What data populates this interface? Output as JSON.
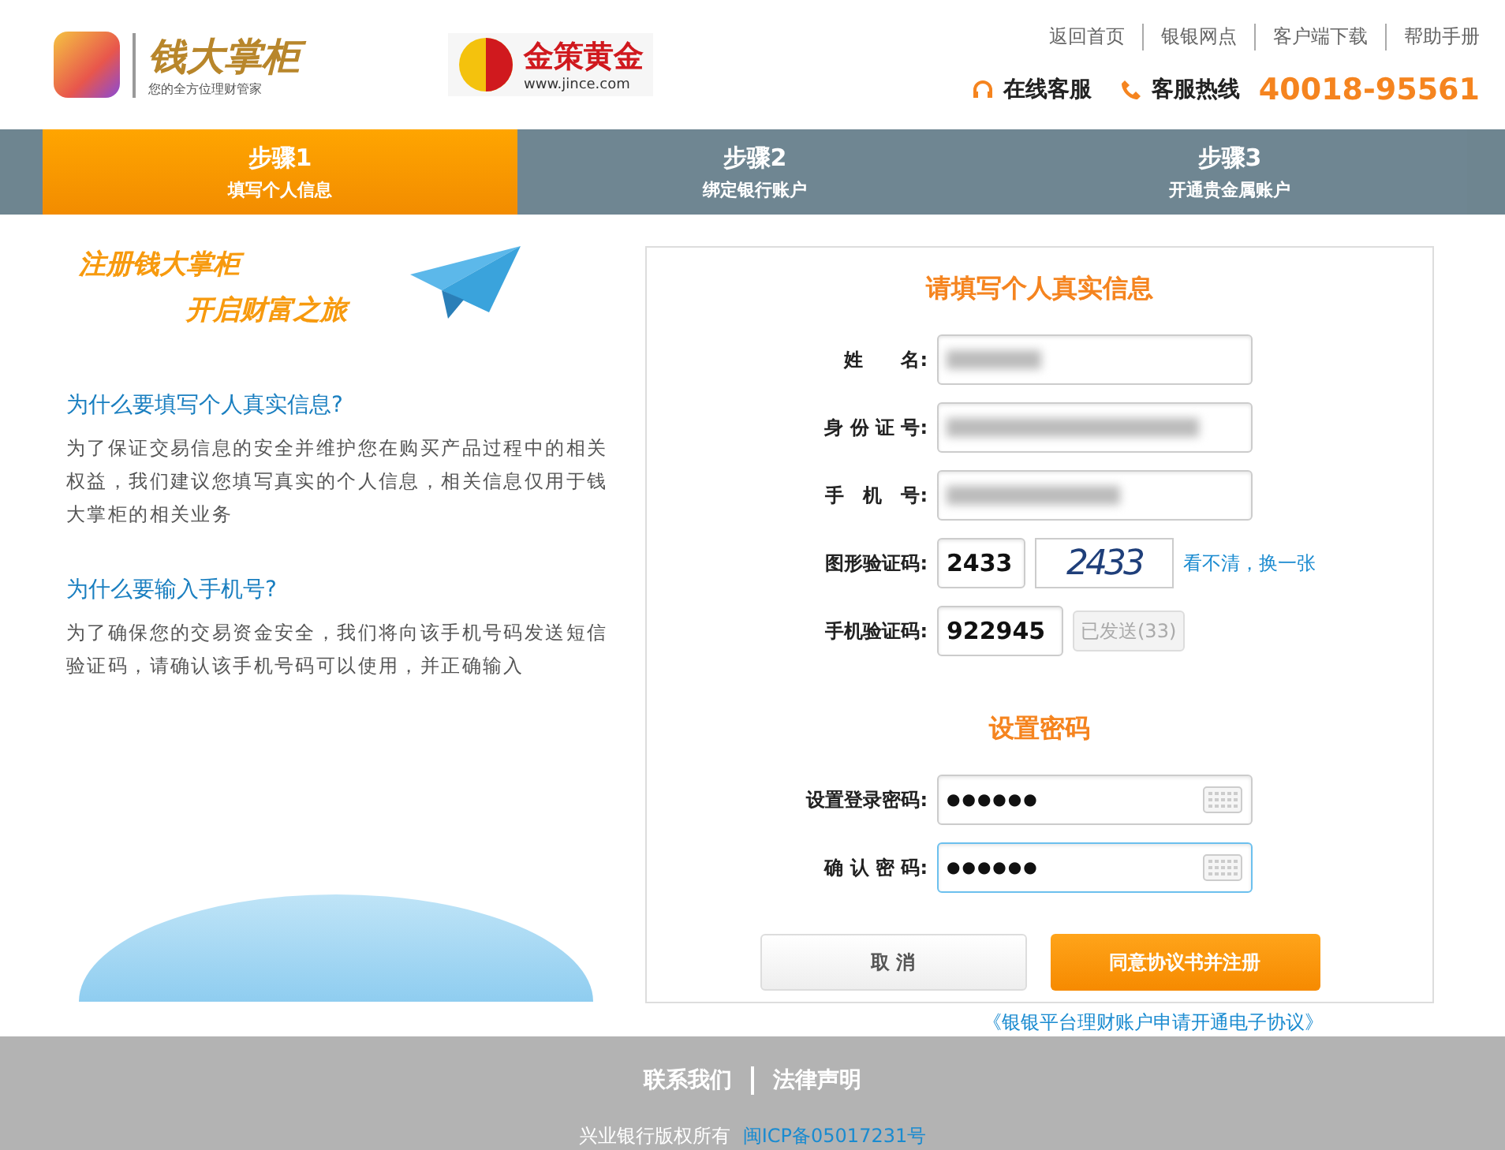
{
  "header": {
    "brand_name": "钱大掌柜",
    "brand_tagline": "您的全方位理财管家",
    "partner_name": "金策黄金",
    "partner_url": "www.jince.com",
    "nav_links": [
      "返回首页",
      "银银网点",
      "客户端下载",
      "帮助手册"
    ],
    "service_label": "在线客服",
    "hotline_label": "客服热线",
    "hotline_number": "40018-95561"
  },
  "steps": [
    {
      "title": "步骤1",
      "subtitle": "填写个人信息",
      "selected": true
    },
    {
      "title": "步骤2",
      "subtitle": "绑定银行账户",
      "selected": false
    },
    {
      "title": "步骤3",
      "subtitle": "开通贵金属账户",
      "selected": false
    }
  ],
  "intro": {
    "slogan_lines": [
      "注册钱大掌柜",
      "开启财富之旅"
    ],
    "sections": [
      {
        "heading": "为什么要填写个人真实信息?",
        "body": "为了保证交易信息的安全并维护您在购买产品过程中的相关权益，我们建议您填写真实的个人信息，相关信息仅用于钱大掌柜的相关业务"
      },
      {
        "heading": "为什么要输入手机号?",
        "body": "为了确保您的交易资金安全，我们将向该手机号码发送短信验证码，请确认该手机号码可以使用，并正确输入"
      }
    ]
  },
  "form": {
    "title": "请填写个人真实信息",
    "fields": [
      {
        "kind": "blurred",
        "label": "姓　　名:"
      },
      {
        "kind": "blurred",
        "label": "身 份 证 号:"
      },
      {
        "kind": "blurred",
        "label": "手　机　号:"
      },
      {
        "kind": "captcha",
        "label": "图形验证码:",
        "value": "2433",
        "captcha_text": "2433",
        "refresh_link": "看不清，换一张"
      },
      {
        "kind": "sms",
        "label": "手机验证码:",
        "value": "922945",
        "send_button": "已发送(33)",
        "disabled": true
      }
    ],
    "password_title": "设置密码",
    "password_fields": [
      {
        "label": "设置登录密码:",
        "value": "●●●●●●",
        "focused": false
      },
      {
        "label": "确 认 密 码:",
        "value": "●●●●●●",
        "focused": true
      }
    ],
    "cancel_button": "取 消",
    "submit_button": "同意协议书并注册",
    "agreement_link": "《银银平台理财账户申请开通电子协议》"
  },
  "footer": {
    "links": [
      "联系我们",
      "法律声明"
    ],
    "copyright": "兴业银行版权所有",
    "icp": "闽ICP备05017231号"
  }
}
